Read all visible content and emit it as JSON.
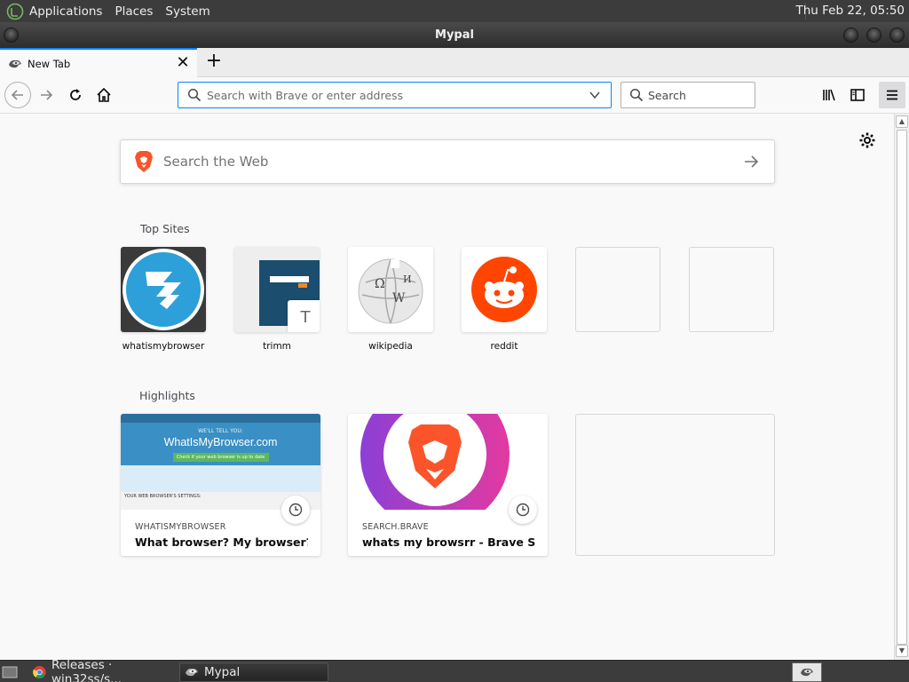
{
  "system_panel": {
    "menus": [
      "Applications",
      "Places",
      "System"
    ],
    "clock": "Thu Feb 22, 05:50"
  },
  "window": {
    "title": "Mypal"
  },
  "tabs": [
    {
      "label": "New Tab",
      "favicon": "mypal-raccoon-icon"
    }
  ],
  "toolbar": {
    "url_placeholder": "Search with Brave or enter address",
    "search_placeholder": "Search"
  },
  "newtab_page": {
    "web_search_placeholder": "Search the Web",
    "top_sites_title": "Top Sites",
    "top_sites": [
      {
        "name": "whatismybrowser",
        "icon": "whatismybrowser-logo"
      },
      {
        "name": "trimm",
        "icon": "trimm-screenshot",
        "letter": "T"
      },
      {
        "name": "wikipedia",
        "icon": "wikipedia-globe-logo"
      },
      {
        "name": "reddit",
        "icon": "reddit-logo"
      }
    ],
    "highlights_title": "Highlights",
    "highlights": [
      {
        "host": "WHATISMYBROWSER",
        "title": "What browser? My browser?…",
        "thumb_text": "WhatIsMyBrowser.com",
        "thumb_sub": "WE'LL TELL YOU:",
        "thumb_link": "Check if your web browser is up to date",
        "thumb_bottom": "YOUR WEB BROWSER'S SETTINGS:"
      },
      {
        "host": "SEARCH.BRAVE",
        "title": "whats my browsrr - Brave Se…"
      }
    ]
  },
  "taskbar": {
    "items": [
      {
        "label": "Releases · win32ss/s...",
        "icon": "chrome-icon"
      },
      {
        "label": "Mypal",
        "icon": "mypal-raccoon-icon"
      }
    ]
  },
  "colors": {
    "accent": "#0a84ff",
    "reddit": "#ff4500",
    "whatismybrowser": "#2d9fd9",
    "brave": "#fb542b"
  }
}
